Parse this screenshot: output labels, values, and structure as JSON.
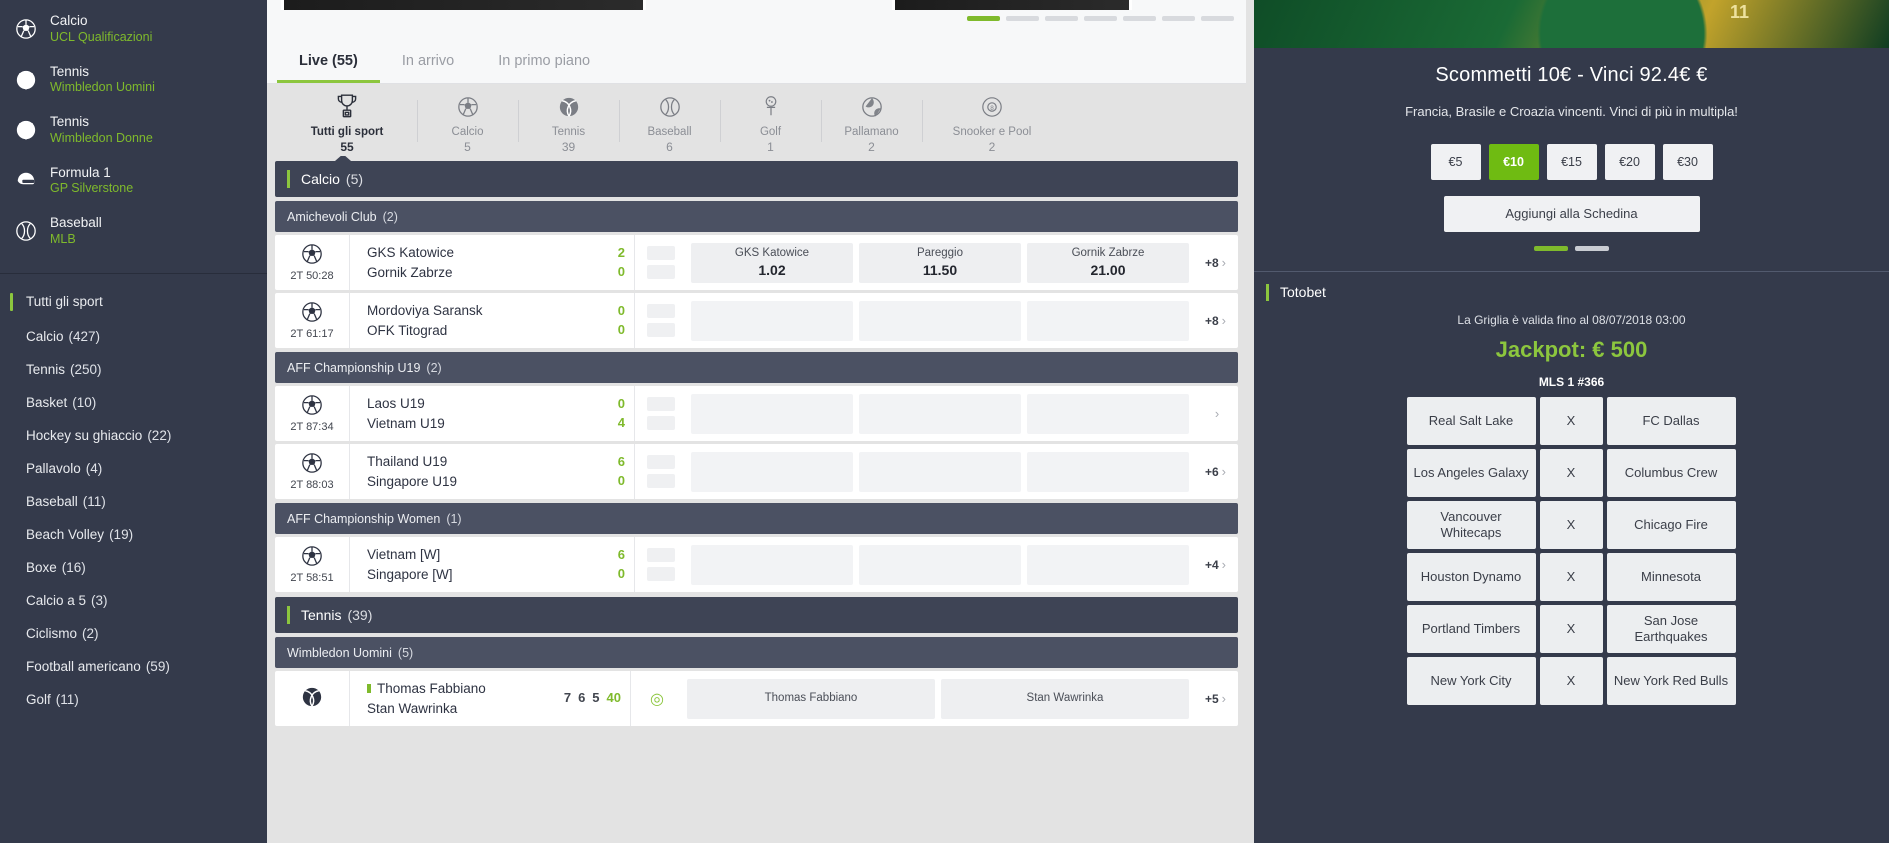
{
  "sidebar": {
    "highlights": [
      {
        "icon": "soccer-ball-icon",
        "sport": "Calcio",
        "league": "UCL Qualificazioni"
      },
      {
        "icon": "tennis-ball-icon",
        "sport": "Tennis",
        "league": "Wimbledon Uomini"
      },
      {
        "icon": "tennis-ball-icon",
        "sport": "Tennis",
        "league": "Wimbledon Donne"
      },
      {
        "icon": "racing-helmet-icon",
        "sport": "Formula 1",
        "league": "GP Silverstone"
      },
      {
        "icon": "baseball-icon",
        "sport": "Baseball",
        "league": "MLB"
      }
    ],
    "sports": [
      {
        "label": "Tutti gli sport",
        "count": "",
        "active": true
      },
      {
        "label": "Calcio",
        "count": "(427)",
        "active": false
      },
      {
        "label": "Tennis",
        "count": "(250)",
        "active": false
      },
      {
        "label": "Basket",
        "count": "(10)",
        "active": false
      },
      {
        "label": "Hockey su ghiaccio",
        "count": "(22)",
        "active": false
      },
      {
        "label": "Pallavolo",
        "count": "(4)",
        "active": false
      },
      {
        "label": "Baseball",
        "count": "(11)",
        "active": false
      },
      {
        "label": "Beach Volley",
        "count": "(19)",
        "active": false
      },
      {
        "label": "Boxe",
        "count": "(16)",
        "active": false
      },
      {
        "label": "Calcio a 5",
        "count": "(3)",
        "active": false
      },
      {
        "label": "Ciclismo",
        "count": "(2)",
        "active": false
      },
      {
        "label": "Football americano",
        "count": "(59)",
        "active": false
      },
      {
        "label": "Golf",
        "count": "(11)",
        "active": false
      }
    ]
  },
  "center": {
    "tabs": [
      {
        "label": "Live (55)",
        "active": true
      },
      {
        "label": "In arrivo",
        "active": false
      },
      {
        "label": "In primo piano",
        "active": false
      }
    ],
    "sport_filters": [
      {
        "icon": "trophy-icon",
        "name": "Tutti gli sport",
        "count": "55",
        "active": true
      },
      {
        "icon": "soccer-ball-icon",
        "name": "Calcio",
        "count": "5",
        "active": false
      },
      {
        "icon": "tennis-ball-icon",
        "name": "Tennis",
        "count": "39",
        "active": false
      },
      {
        "icon": "baseball-icon",
        "name": "Baseball",
        "count": "6",
        "active": false
      },
      {
        "icon": "golf-tee-icon",
        "name": "Golf",
        "count": "1",
        "active": false
      },
      {
        "icon": "handball-icon",
        "name": "Pallamano",
        "count": "2",
        "active": false
      },
      {
        "icon": "snooker-ball-icon",
        "name": "Snooker e Pool",
        "count": "2",
        "active": false
      }
    ],
    "sections": [
      {
        "type": "sport",
        "name": "Calcio",
        "count": "(5)"
      },
      {
        "type": "league",
        "name": "Amichevoli Club",
        "count": "(2)"
      },
      {
        "type": "match",
        "icon": "soccer-ball-icon",
        "clock": "2T 50:28",
        "home": "GKS Katowice",
        "away": "Gornik Zabrze",
        "home_score": "2",
        "away_score": "0",
        "odds": [
          {
            "label": "GKS Katowice",
            "value": "1.02"
          },
          {
            "label": "Pareggio",
            "value": "11.50"
          },
          {
            "label": "Gornik Zabrze",
            "value": "21.00"
          }
        ],
        "more": "+8"
      },
      {
        "type": "match",
        "icon": "soccer-ball-icon",
        "clock": "2T 61:17",
        "home": "Mordoviya Saransk",
        "away": "OFK Titograd",
        "home_score": "0",
        "away_score": "0",
        "odds": [
          {
            "label": "",
            "value": ""
          },
          {
            "label": "",
            "value": ""
          },
          {
            "label": "",
            "value": ""
          }
        ],
        "more": "+8"
      },
      {
        "type": "league",
        "name": "AFF Championship U19",
        "count": "(2)"
      },
      {
        "type": "match",
        "icon": "soccer-ball-icon",
        "clock": "2T 87:34",
        "home": "Laos U19",
        "away": "Vietnam U19",
        "home_score": "0",
        "away_score": "4",
        "odds": [
          {
            "label": "",
            "value": ""
          },
          {
            "label": "",
            "value": ""
          },
          {
            "label": "",
            "value": ""
          }
        ],
        "more": ""
      },
      {
        "type": "match",
        "icon": "soccer-ball-icon",
        "clock": "2T 88:03",
        "home": "Thailand U19",
        "away": "Singapore U19",
        "home_score": "6",
        "away_score": "0",
        "odds": [
          {
            "label": "",
            "value": ""
          },
          {
            "label": "",
            "value": ""
          },
          {
            "label": "",
            "value": ""
          }
        ],
        "more": "+6"
      },
      {
        "type": "league",
        "name": "AFF Championship Women",
        "count": "(1)"
      },
      {
        "type": "match",
        "icon": "soccer-ball-icon",
        "clock": "2T 58:51",
        "home": "Vietnam [W]",
        "away": "Singapore [W]",
        "home_score": "6",
        "away_score": "0",
        "odds": [
          {
            "label": "",
            "value": ""
          },
          {
            "label": "",
            "value": ""
          },
          {
            "label": "",
            "value": ""
          }
        ],
        "more": "+4"
      },
      {
        "type": "sport",
        "name": "Tennis",
        "count": "(39)"
      },
      {
        "type": "league",
        "name": "Wimbledon Uomini",
        "count": "(5)"
      },
      {
        "type": "match_tennis",
        "icon": "tennis-ball-icon",
        "clock": "",
        "home": "Thomas Fabbiano",
        "away": "Stan Wawrinka",
        "home_sets": "7 6 5",
        "home_point": "40",
        "away_sets": "",
        "away_point": "",
        "odds": [
          {
            "label": "Thomas Fabbiano",
            "value": ""
          },
          {
            "label": "Stan Wawrinka",
            "value": ""
          }
        ],
        "more": "+5"
      }
    ]
  },
  "right": {
    "banner": {
      "jersey_number": "11"
    },
    "promo": {
      "title": "Scommetti 10€ - Vinci 92.4€ €",
      "subtitle": "Francia, Brasile e Croazia vincenti. Vinci di più in multipla!",
      "chips": [
        {
          "label": "€5",
          "selected": false
        },
        {
          "label": "€10",
          "selected": true
        },
        {
          "label": "€15",
          "selected": false
        },
        {
          "label": "€20",
          "selected": false
        },
        {
          "label": "€30",
          "selected": false
        }
      ],
      "cta": "Aggiungi alla Schedina"
    },
    "totobet": {
      "title": "Totobet",
      "validity": "La Griglia è valida fino al 08/07/2018 03:00",
      "jackpot": "Jackpot: € 500",
      "code": "MLS 1 #366",
      "rows": [
        {
          "home": "Real Salt Lake",
          "draw": "X",
          "away": "FC Dallas"
        },
        {
          "home": "Los Angeles Galaxy",
          "draw": "X",
          "away": "Columbus Crew"
        },
        {
          "home": "Vancouver Whitecaps",
          "draw": "X",
          "away": "Chicago Fire"
        },
        {
          "home": "Houston Dynamo",
          "draw": "X",
          "away": "Minnesota"
        },
        {
          "home": "Portland Timbers",
          "draw": "X",
          "away": "San Jose Earthquakes"
        },
        {
          "home": "New York City",
          "draw": "X",
          "away": "New York Red Bulls"
        }
      ]
    }
  },
  "colors": {
    "accent_green": "#8cc63e",
    "dark_navy": "#343a4b",
    "header_navy": "#3e4455",
    "league_navy": "#4b5163"
  }
}
